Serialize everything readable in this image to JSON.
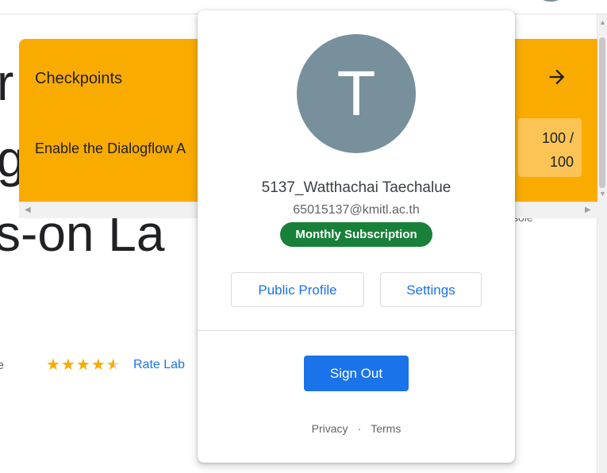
{
  "background": {
    "title_line1": "r",
    "title_line2": "gl",
    "title_line3": "s-on La",
    "small_text": "e",
    "rating": {
      "filled_stars": 4.5,
      "max_stars": 5
    },
    "rate_link": "Rate Lab",
    "console_fragment": "sole"
  },
  "checkpoints": {
    "title": "Checkpoints",
    "task": "Enable the Dialogflow A",
    "score": "100 /",
    "score_total": "100"
  },
  "account_popup": {
    "avatar_letter": "T",
    "name": "5137_Watthachai Taechalue",
    "email": "65015137@kmitl.ac.th",
    "subscription_badge": "Monthly Subscription",
    "public_profile_label": "Public Profile",
    "settings_label": "Settings",
    "sign_out_label": "Sign Out",
    "privacy_label": "Privacy",
    "separator": "·",
    "terms_label": "Terms"
  },
  "colors": {
    "checkpoint_bg": "#f9ab00",
    "avatar_bg": "#78909c",
    "badge_green": "#188038",
    "primary_blue": "#1a73e8"
  }
}
